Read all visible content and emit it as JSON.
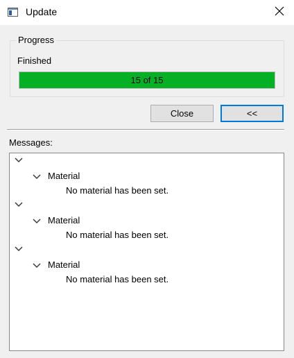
{
  "window": {
    "title": "Update",
    "app_icon": "window-icon",
    "close_icon": "close-icon"
  },
  "progress_group": {
    "title": "Progress",
    "status": "Finished",
    "bar_text": "15 of 15",
    "completed": 15,
    "total": 15,
    "bar_color": "#06b025"
  },
  "buttons": {
    "close_label": "Close",
    "collapse_label": "<<",
    "focus_color": "#0078d7"
  },
  "messages": {
    "label": "Messages:",
    "groups": [
      {
        "category": "Material",
        "message": "No material has been set."
      },
      {
        "category": "Material",
        "message": "No material has been set."
      },
      {
        "category": "Material",
        "message": "No material has been set."
      }
    ]
  }
}
